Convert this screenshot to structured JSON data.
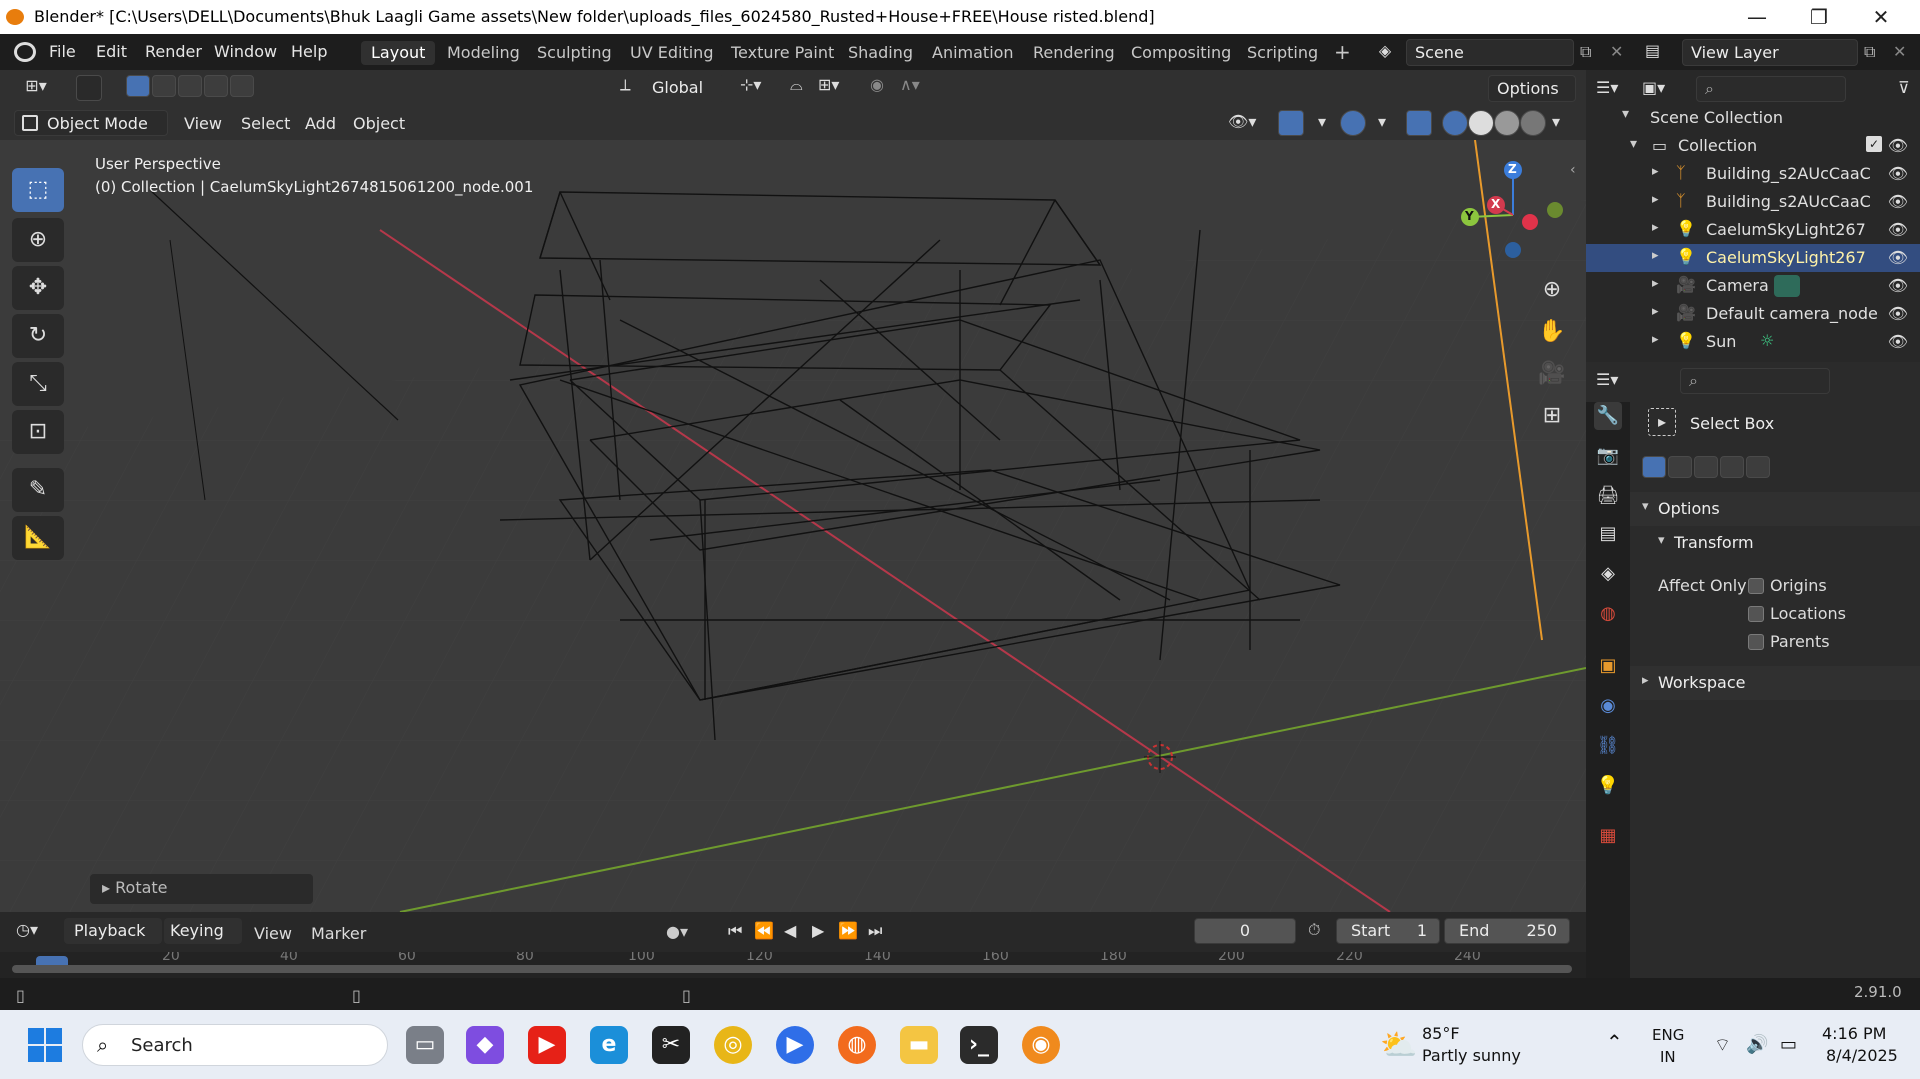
{
  "window": {
    "title": "Blender* [C:\\Users\\DELL\\Documents\\Bhuk Laagli Game  assets\\New folder\\uploads_files_6024580_Rusted+House+FREE\\House risted.blend]",
    "minimize": "—",
    "maximize": "❐",
    "close": "✕"
  },
  "menu": [
    "File",
    "Edit",
    "Render",
    "Window",
    "Help"
  ],
  "workspaces": [
    "Layout",
    "Modeling",
    "Sculpting",
    "UV Editing",
    "Texture Paint",
    "Shading",
    "Animation",
    "Rendering",
    "Compositing",
    "Scripting"
  ],
  "add_workspace": "+",
  "scene_name": "Scene",
  "view_layer": "View Layer",
  "header": {
    "transform_orientation": "Global",
    "options": "Options",
    "mode": "Object Mode",
    "view": "View",
    "select": "Select",
    "add": "Add",
    "object": "Object"
  },
  "viewport": {
    "perspective": "User Perspective",
    "collection_info": "(0) Collection | CaelumSkyLight2674815061200_node.001",
    "last_op": "Rotate",
    "axis_x": "X",
    "axis_y": "Y",
    "axis_z": "Z"
  },
  "outliner": {
    "root": "Scene Collection",
    "collection": "Collection",
    "items": [
      {
        "name": "Building_s2AUcCaaC",
        "icon": "armature-icon"
      },
      {
        "name": "Building_s2AUcCaaC",
        "icon": "armature-icon"
      },
      {
        "name": "CaelumSkyLight267",
        "icon": "light-icon"
      },
      {
        "name": "CaelumSkyLight267",
        "icon": "light-icon",
        "selected": true
      },
      {
        "name": "Camera",
        "icon": "camera-icon"
      },
      {
        "name": "Default camera_node",
        "icon": "camera-icon"
      },
      {
        "name": "Sun",
        "icon": "light-icon"
      }
    ]
  },
  "properties": {
    "tool_name": "Select Box",
    "options_label": "Options",
    "transform_label": "Transform",
    "affect_only": "Affect Only",
    "origins": "Origins",
    "locations": "Locations",
    "parents": "Parents",
    "workspace": "Workspace"
  },
  "timeline": {
    "playback": "Playback",
    "keying": "Keying",
    "view": "View",
    "marker": "Marker",
    "current_frame": "0",
    "start_label": "Start",
    "start": "1",
    "end_label": "End",
    "end": "250",
    "ruler": [
      "0",
      "20",
      "40",
      "60",
      "80",
      "100",
      "120",
      "140",
      "160",
      "180",
      "200",
      "220",
      "240"
    ]
  },
  "status": {
    "version": "2.91.0"
  },
  "taskbar": {
    "search": "Search",
    "weather_temp": "85°F",
    "weather_desc": "Partly sunny",
    "lang1": "ENG",
    "lang2": "IN",
    "time": "4:16 PM",
    "date": "8/4/2025"
  },
  "colors": {
    "accent": "#4772b3",
    "selected_row": "#334d80",
    "x_axis": "#b5384a",
    "y_axis": "#6e9a2e",
    "z_axis": "#3b7ddb",
    "camera_line": "#e89a2c"
  }
}
